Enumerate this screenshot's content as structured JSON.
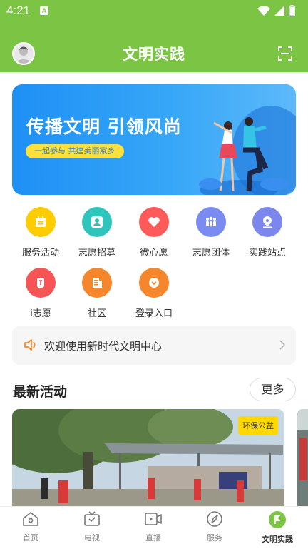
{
  "status_bar": {
    "time": "4:21",
    "badge": "A"
  },
  "header": {
    "title": "文明实践"
  },
  "banner": {
    "headline": "传播文明 引领风尚",
    "pill": "一起参与 共建美丽家乡"
  },
  "grid": [
    {
      "label": "服务活动",
      "icon": "calendar-icon",
      "color": "#ffcc00"
    },
    {
      "label": "志愿招募",
      "icon": "volunteer-person-icon",
      "color": "#2fc5bc"
    },
    {
      "label": "微心愿",
      "icon": "heart-icon",
      "color": "#ff5a5a"
    },
    {
      "label": "志愿团体",
      "icon": "group-icon",
      "color": "#7a8cf2"
    },
    {
      "label": "实践站点",
      "icon": "location-person-icon",
      "color": "#7c87ee"
    },
    {
      "label": "i志愿",
      "icon": "hand-icon",
      "color": "#f75555"
    },
    {
      "label": "社区",
      "icon": "building-icon",
      "color": "#f6862b"
    },
    {
      "label": "登录入口",
      "icon": "login-entry-icon",
      "color": "#f6862b"
    }
  ],
  "notice": {
    "text": "欢迎使用新时代文明中心"
  },
  "section": {
    "title": "最新活动",
    "more_label": "更多"
  },
  "activity": {
    "tag": "环保公益"
  },
  "nav": [
    {
      "label": "首页",
      "icon": "home-icon"
    },
    {
      "label": "电视",
      "icon": "tv-icon"
    },
    {
      "label": "直播",
      "icon": "live-video-icon"
    },
    {
      "label": "服务",
      "icon": "compass-icon"
    },
    {
      "label": "文明实践",
      "icon": "flag-icon"
    }
  ],
  "colors": {
    "brand_green": "#7cc544",
    "banner_blue": "#1e90f5",
    "accent_yellow": "#ffe13a"
  }
}
